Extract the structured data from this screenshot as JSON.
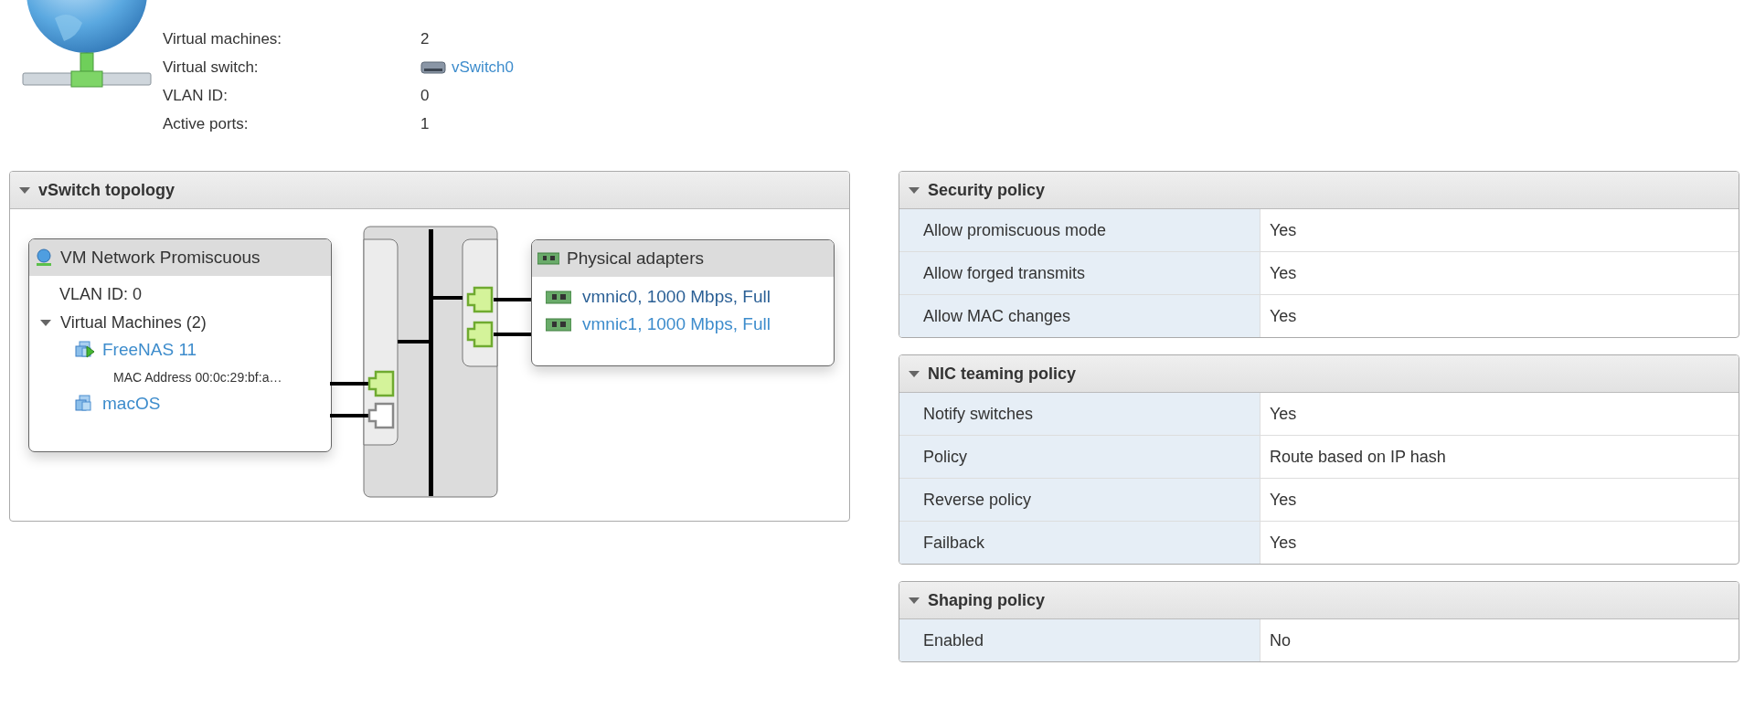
{
  "summary": {
    "rows": [
      {
        "label": "Virtual machines:",
        "value": "2",
        "kind": "text"
      },
      {
        "label": "Virtual switch:",
        "value": "vSwitch0",
        "kind": "link"
      },
      {
        "label": "VLAN ID:",
        "value": "0",
        "kind": "text"
      },
      {
        "label": "Active ports:",
        "value": "1",
        "kind": "text"
      }
    ]
  },
  "topology": {
    "title": "vSwitch topology",
    "expanded": true,
    "port_group": {
      "name": "VM Network Promiscuous",
      "vlan": "VLAN ID: 0",
      "vm_section": {
        "label": "Virtual Machines (2)",
        "expanded": true
      },
      "vms": [
        {
          "name": "FreeNAS 11",
          "powered_on": true,
          "mac": "MAC Address 00:0c:29:bf:a…",
          "port_connected": true
        },
        {
          "name": "macOS",
          "powered_on": false,
          "port_connected": false
        }
      ]
    },
    "uplinks": {
      "title": "Physical adapters",
      "adapters": [
        {
          "label": "vmnic0, 1000 Mbps, Full",
          "selected": true,
          "port_connected": true
        },
        {
          "label": "vmnic1, 1000 Mbps, Full",
          "selected": false,
          "port_connected": true
        }
      ]
    }
  },
  "policies": [
    {
      "title": "Security policy",
      "expanded": true,
      "rows": [
        {
          "label": "Allow promiscuous mode",
          "value": "Yes"
        },
        {
          "label": "Allow forged transmits",
          "value": "Yes"
        },
        {
          "label": "Allow MAC changes",
          "value": "Yes"
        }
      ]
    },
    {
      "title": "NIC teaming policy",
      "expanded": true,
      "rows": [
        {
          "label": "Notify switches",
          "value": "Yes"
        },
        {
          "label": "Policy",
          "value": "Route based on IP hash"
        },
        {
          "label": "Reverse policy",
          "value": "Yes"
        },
        {
          "label": "Failback",
          "value": "Yes"
        }
      ]
    },
    {
      "title": "Shaping policy",
      "expanded": true,
      "rows": [
        {
          "label": "Enabled",
          "value": "No"
        }
      ]
    }
  ]
}
